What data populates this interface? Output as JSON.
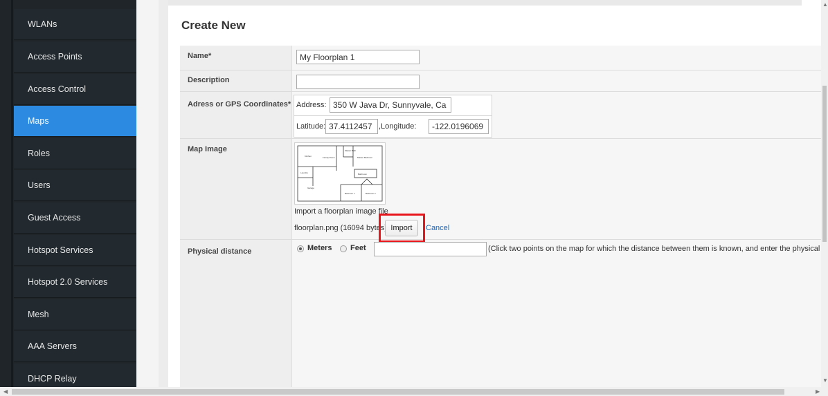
{
  "sidebar": {
    "items": [
      {
        "label": "WLANs"
      },
      {
        "label": "Access Points"
      },
      {
        "label": "Access Control"
      },
      {
        "label": "Maps"
      },
      {
        "label": "Roles"
      },
      {
        "label": "Users"
      },
      {
        "label": "Guest Access"
      },
      {
        "label": "Hotspot Services"
      },
      {
        "label": "Hotspot 2.0 Services"
      },
      {
        "label": "Mesh"
      },
      {
        "label": "AAA Servers"
      },
      {
        "label": "DHCP Relay"
      }
    ],
    "active": "Maps",
    "accent": "#2c8be0"
  },
  "page": {
    "title": "Create New"
  },
  "form": {
    "name_label": "Name*",
    "name_value": "My Floorplan 1",
    "description_label": "Description",
    "description_value": "",
    "address_label": "Adress or GPS Coordinates*",
    "address_prefix": "Address:",
    "address_value": "350 W Java Dr, Sunnyvale, Ca",
    "latitude_prefix": "Latitude:",
    "latitude_value": "37.4112457",
    "longitude_prefix": ",Longitude:",
    "longitude_value": "-122.0196069",
    "map_image_label": "Map Image",
    "import_hint": "Import a floorplan image file",
    "file_info": "floorplan.png (16094 bytes)",
    "import_button": "Import",
    "cancel_link": "Cancel",
    "distance_label": "Physical distance",
    "unit_meters": "Meters",
    "unit_feet": "Feet",
    "distance_value": "",
    "distance_hint": "(Click two points on the map for which the distance between them is known, and enter the physical dista",
    "selected_unit": "Meters"
  },
  "highlight_color": "#e8161b"
}
